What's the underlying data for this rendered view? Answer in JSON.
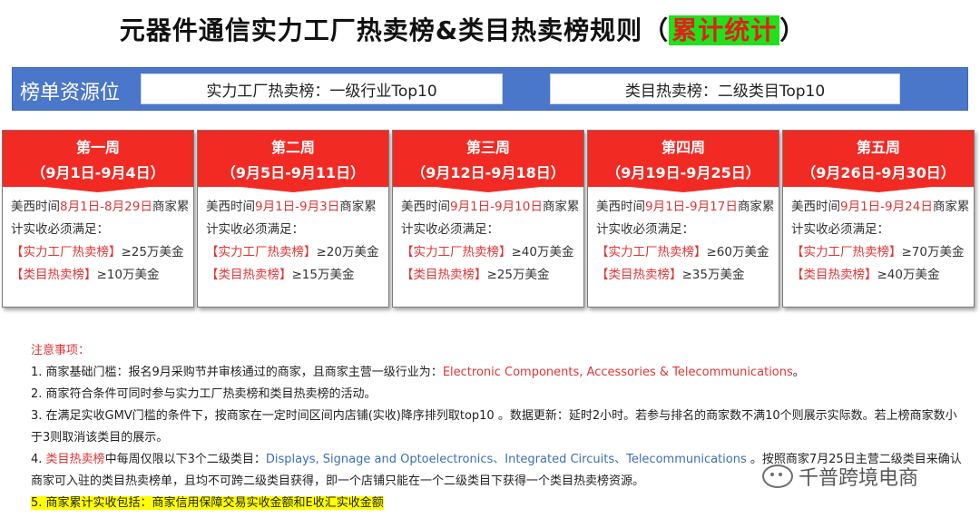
{
  "title": {
    "main": "元器件通信实力工厂热卖榜&类目热卖榜规则（",
    "highlight": "累计统计",
    "close": "）"
  },
  "resource": {
    "label": "榜单资源位",
    "box_a": "实力工厂热卖榜：一级行业Top10",
    "box_b": "类目热卖榜：二级类目Top10"
  },
  "weeks": [
    {
      "name": "第一周",
      "range": "（9月1日-9月4日）",
      "prefix": "美西时间",
      "period": "8月1日-8月29日",
      "suffix": "商家累",
      "line2": "计实收必须满足：",
      "factory_tag": "【实力工厂热卖榜】",
      "factory_val": "≥25万美金",
      "cat_tag": "【类目热卖榜】",
      "cat_val": "≥10万美金"
    },
    {
      "name": "第二周",
      "range": "（9月5日-9月11日）",
      "prefix": "美西时间",
      "period": "9月1日-9月3日",
      "suffix": "商家累",
      "line2": "计实收必须满足：",
      "factory_tag": "【实力工厂热卖榜】",
      "factory_val": "≥20万美金",
      "cat_tag": "【类目热卖榜】",
      "cat_val": "≥15万美金"
    },
    {
      "name": "第三周",
      "range": "（9月12日-9月18日）",
      "prefix": "美西时间",
      "period": "9月1日-9月10日",
      "suffix": "商家累",
      "line2": "计实收必须满足：",
      "factory_tag": "【实力工厂热卖榜】",
      "factory_val": "≥40万美金",
      "cat_tag": "【类目热卖榜】",
      "cat_val": "≥25万美金"
    },
    {
      "name": "第四周",
      "range": "（9月19日-9月25日）",
      "prefix": "美西时间",
      "period": "9月1日-9月17日",
      "suffix": "商家累",
      "line2": "计实收必须满足：",
      "factory_tag": "【实力工厂热卖榜】",
      "factory_val": "≥60万美金",
      "cat_tag": "【类目热卖榜】",
      "cat_val": "≥35万美金"
    },
    {
      "name": "第五周",
      "range": "（9月26日-9月30日）",
      "prefix": "美西时间",
      "period": "9月1日-9月24日",
      "suffix": "商家累",
      "line2": "计实收必须满足：",
      "factory_tag": "【实力工厂热卖榜】",
      "factory_val": "≥70万美金",
      "cat_tag": "【类目热卖榜】",
      "cat_val": "≥40万美金"
    }
  ],
  "notes": {
    "title": "注意事项：",
    "n1_a": "1. 商家基础门槛：报名9月采购节并审核通过的商家，且商家主营一级行业为：",
    "n1_b": "Electronic Components, Accessories & Telecommunications",
    "n1_c": "。",
    "n2": "2. 商家符合条件可同时参与实力工厂热卖榜和类目热卖榜的活动。",
    "n3": "3. 在满足实收GMV门槛的条件下，按商家在一定时间区间内店铺(实收)降序排列取top10 。数据更新：延时2小时。若参与排名的商家数不满10个则展示实际数。若上榜商家数小于3则取消该类目的展示。",
    "n4_a": "4. ",
    "n4_b": "类目热卖榜",
    "n4_c": "中每周仅限以下3个二级类目：",
    "n4_d": "Displays, Signage and Optoelectronics、Integrated Circuits、Telecommunications",
    "n4_e": " 。按照商家7月25日主营二级类目来确认商家可入驻的类目热卖榜单，且均不可跨二级类目获得，即一个店铺只能在一个二级类目下获得一个类目热卖榜资源。",
    "n5": "5. 商家累计实收包括：商家信用保障交易实收金额和E收汇实收金额"
  },
  "watermark": {
    "icon": "wechat-icon",
    "text": "千普跨境电商"
  },
  "colors": {
    "accent_red": "#f22a24",
    "bar_blue": "#4a77c9",
    "highlight_green": "#22e01c",
    "note_blue": "#3c6fb6"
  }
}
